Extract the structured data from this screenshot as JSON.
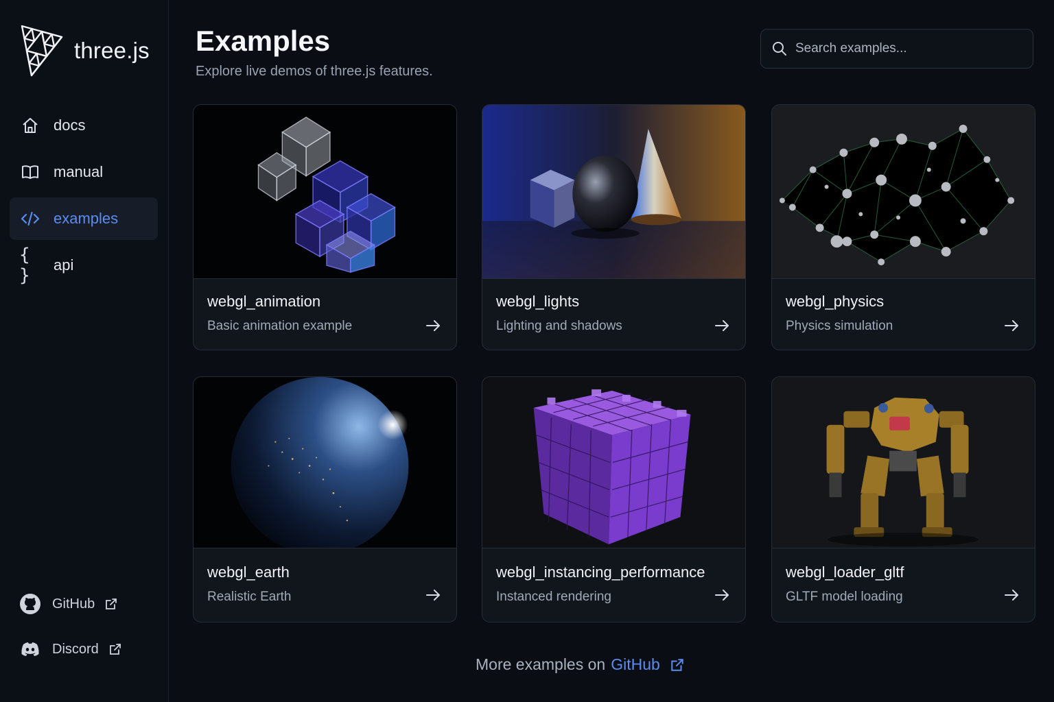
{
  "brand": {
    "name": "three.js",
    "logo_icon": "threejs-logo-icon"
  },
  "sidebar": {
    "items": [
      {
        "label": "docs",
        "icon": "home-icon",
        "active": false
      },
      {
        "label": "manual",
        "icon": "book-icon",
        "active": false
      },
      {
        "label": "examples",
        "icon": "code-icon",
        "active": true
      },
      {
        "label": "api",
        "icon": "braces-icon",
        "active": false
      }
    ],
    "links": [
      {
        "label": "GitHub",
        "icon": "github-icon"
      },
      {
        "label": "Discord",
        "icon": "discord-icon"
      }
    ]
  },
  "header": {
    "title": "Examples",
    "subtitle": "Explore live demos of three.js features."
  },
  "search": {
    "placeholder": "Search examples..."
  },
  "examples": [
    {
      "name": "webgl_animation",
      "description": "Basic animation example"
    },
    {
      "name": "webgl_lights",
      "description": "Lighting and shadows"
    },
    {
      "name": "webgl_physics",
      "description": "Physics simulation"
    },
    {
      "name": "webgl_earth",
      "description": "Realistic Earth"
    },
    {
      "name": "webgl_instancing_performance",
      "description": "Instanced rendering"
    },
    {
      "name": "webgl_loader_gltf",
      "description": "GLTF model loading"
    }
  ],
  "footer": {
    "prefix": "More examples on",
    "link_label": "GitHub"
  },
  "colors": {
    "accent": "#5b8def",
    "background": "#0a0d13",
    "card": "#11151c"
  }
}
